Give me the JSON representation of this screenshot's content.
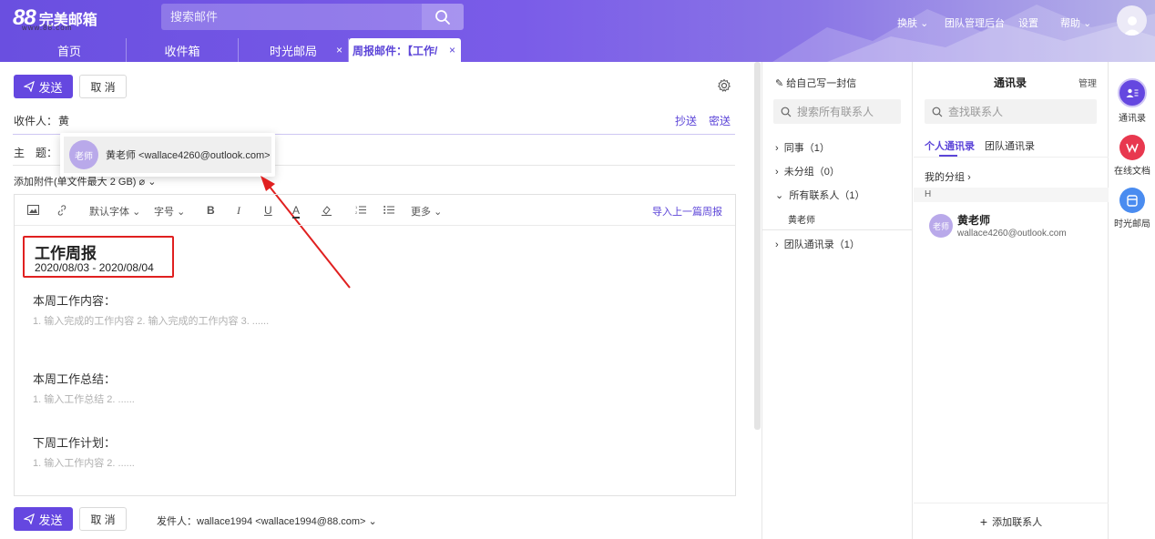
{
  "app": {
    "logo_number": "88",
    "logo_name": "完美邮箱",
    "logo_url": "www.88.com"
  },
  "header": {
    "search_placeholder": "搜索邮件",
    "menu": [
      "换肤",
      "团队管理后台",
      "设置",
      "帮助"
    ]
  },
  "tabs": [
    {
      "label": "首页"
    },
    {
      "label": "收件箱"
    },
    {
      "label": "时光邮局",
      "close": "×"
    },
    {
      "label": "周报邮件：【工作/",
      "close": "×"
    }
  ],
  "compose": {
    "send_label": "发送",
    "cancel_label": "取 消",
    "to_label": "收件人：",
    "to_value": "黄",
    "cc_label": "抄送",
    "bcc_label": "密送",
    "subject_label": "主　题：",
    "attach_label": "添加附件(单文件最大 2 GB)",
    "suggestion": {
      "avatar_text": "老师",
      "text": "黄老师 <wallace4260@outlook.com>"
    },
    "toolbar": {
      "font": "默认字体",
      "size": "字号",
      "bold": "B",
      "italic": "I",
      "underline": "U",
      "color": "A",
      "more": "更多",
      "import": "导入上一篇周报"
    },
    "body": {
      "title": "工作周报",
      "date": "2020/08/03 - 2020/08/04",
      "section1": "本周工作内容：",
      "hint1": "1. 输入完成的工作内容 2. 输入完成的工作内容 3. ......",
      "section2": "本周工作总结：",
      "hint2": "1. 输入工作总结 2. ......",
      "section3": "下周工作计划：",
      "hint3": "1. 输入工作内容 2. ......"
    },
    "sender": "发件人：wallace1994 <wallace1994@88.com>"
  },
  "middle": {
    "write_self": "给自己写一封信",
    "search_placeholder": "搜索所有联系人",
    "groups": [
      {
        "label": "同事（1）"
      },
      {
        "label": "未分组（0）"
      },
      {
        "label": "所有联系人（1）"
      },
      {
        "label": "黄老师"
      },
      {
        "label": "团队通讯录（1）"
      }
    ]
  },
  "contacts": {
    "title": "通讯录",
    "manage": "管理",
    "search_placeholder": "查找联系人",
    "tab_personal": "个人通讯录",
    "tab_team": "团队通讯录",
    "my_groups": "我的分组",
    "section": "H",
    "items": [
      {
        "avatar": "老师",
        "name": "黄老师",
        "email": "wallace4260@outlook.com"
      }
    ],
    "add": "添加联系人"
  },
  "sidebar_right": [
    {
      "label": "通讯录",
      "icon": "contacts-icon",
      "color": "#6547e0"
    },
    {
      "label": "在线文档",
      "icon": "doc-icon",
      "color": "#e8384f"
    },
    {
      "label": "时光邮局",
      "icon": "mailbox-icon",
      "color": "#4a8cf0"
    }
  ]
}
